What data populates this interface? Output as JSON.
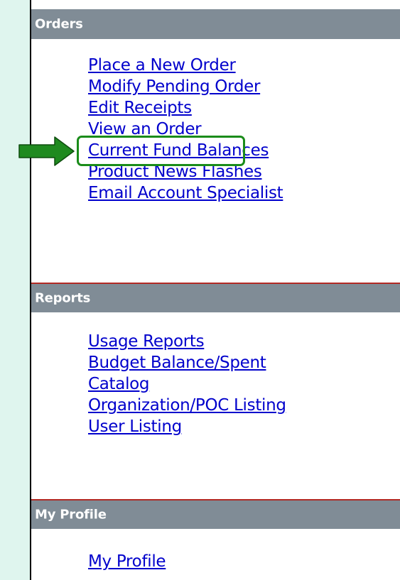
{
  "sections": [
    {
      "title": "Orders",
      "links": [
        "Place a New Order",
        "Modify Pending Order",
        "Edit Receipts",
        "View an Order",
        "Current Fund Balances",
        "Product News Flashes",
        "Email Account Specialist"
      ]
    },
    {
      "title": "Reports",
      "links": [
        "Usage Reports",
        "Budget Balance/Spent",
        "Catalog",
        "Organization/POC Listing",
        "User Listing"
      ]
    },
    {
      "title": "My Profile",
      "links": [
        "My Profile"
      ]
    }
  ],
  "highlight": {
    "target": "View an Order",
    "color": "#1a8c1a"
  },
  "colors": {
    "page_background": "#dff5ee",
    "header_background": "#808c96",
    "header_separator": "#b22a24",
    "link": "#0000cc",
    "arrow": "#1f8a1f"
  }
}
